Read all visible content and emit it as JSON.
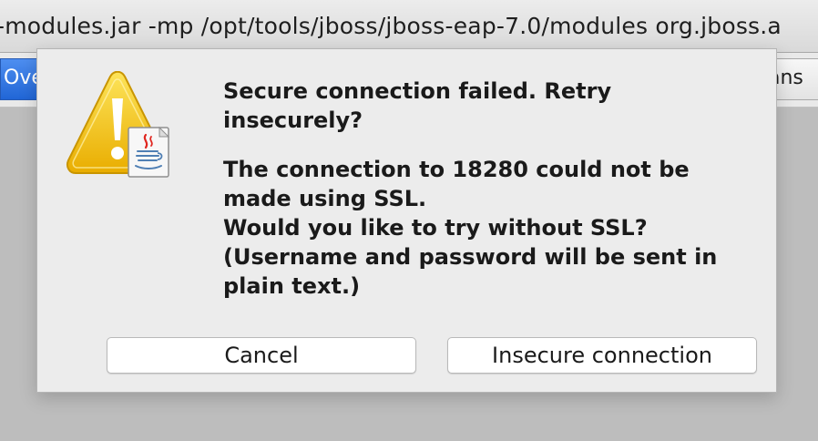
{
  "window": {
    "title": "-modules.jar -mp /opt/tools/jboss/jboss-eap-7.0/modules org.jboss.a",
    "tab_left_label": "Ove",
    "tab_right_label": "ans"
  },
  "dialog": {
    "icon": "warning-triangle-with-java-icon",
    "headline": "Secure connection failed. Retry\ninsecurely?",
    "body_lines": [
      "The connection to 18280 could not be",
      "made using SSL.",
      "Would you like to try without SSL?",
      "(Username and password will be sent in",
      "plain text.)"
    ],
    "buttons": {
      "cancel": "Cancel",
      "insecure": "Insecure connection"
    }
  },
  "colors": {
    "warning_yellow": "#f2c200",
    "tab_selected_blue": "#2f78e3",
    "java_red": "#e0261f",
    "java_blue": "#4f7fb4"
  }
}
